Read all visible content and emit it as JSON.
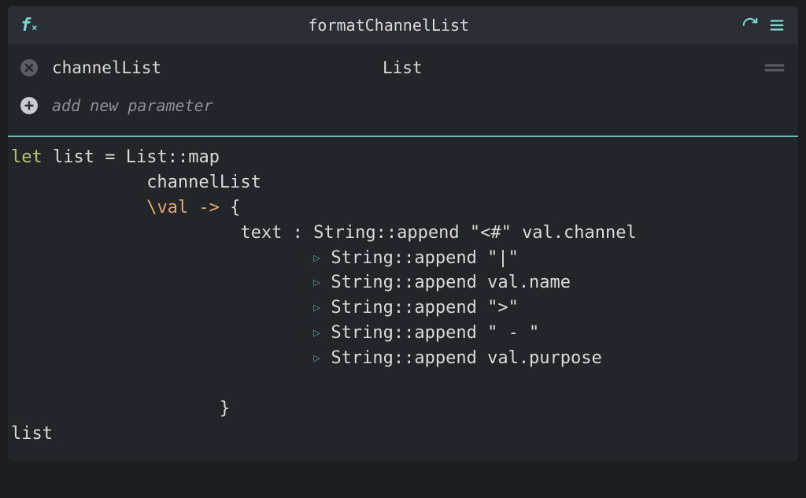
{
  "header": {
    "fx_symbol": "f",
    "fx_sub": "×",
    "title": "formatChannelList"
  },
  "params": [
    {
      "name": "channelList",
      "type": "List"
    }
  ],
  "add_param_label": "add new parameter",
  "code": {
    "let_kw": "let",
    "binding": "list",
    "eq": " = ",
    "fn": "List::map",
    "arg1": "channelList",
    "lambda_prefix": "\\",
    "lambda_var": "val",
    "arrow": " -> ",
    "brace_open": "{",
    "field": "text",
    "colon": " : ",
    "append_fn": "String::append",
    "lit_open": "\"<#\"",
    "val_channel": "val.channel",
    "lit_pipe": "\"|\"",
    "val_name": "val.name",
    "lit_close": "\">\"",
    "lit_dash": "\" - \"",
    "val_purpose": "val.purpose",
    "brace_close": "}",
    "result": "list"
  }
}
